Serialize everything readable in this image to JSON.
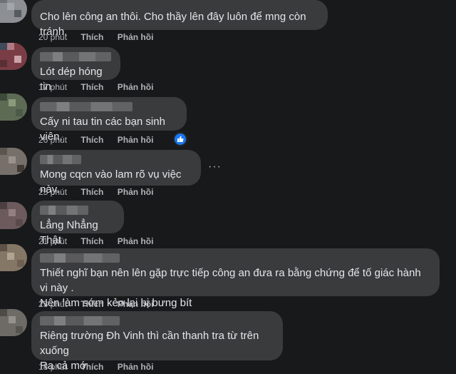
{
  "comments": [
    {
      "text": "Cho lên công an thôi. Cho thầy lên đây luôn để mng còn tránh.",
      "time": "20 phút",
      "like": "Thích",
      "reply": "Phản hồi"
    },
    {
      "text": "Lót dép hóng tin",
      "time": "17 phút",
      "like": "Thích",
      "reply": "Phản hồi"
    },
    {
      "text": "Cấy ni tau tin các bạn sinh viên,",
      "time": "26 phút",
      "like": "Thích",
      "reply": "Phản hồi",
      "reaction": "like-icon"
    },
    {
      "text": "Mong cqcn vào lam rõ vụ việc này.",
      "time": "25 phút",
      "like": "Thích",
      "reply": "Phản hồi",
      "more": "···"
    },
    {
      "text": "Lẳng Nhẳng Thật",
      "time": "21 phút",
      "like": "Thích",
      "reply": "Phản hồi"
    },
    {
      "text": "Thiết nghĩ bạn nên lên gặp trực tiếp công an đưa ra bằng chứng để tố giác hành vi này .\nNên làm sớm kẻo lại bị bưng bít",
      "time": "23 phút",
      "like": "Thích",
      "reply": "Phản hồi"
    },
    {
      "text": "Riêng trường Đh Vinh thì cần thanh tra từ trên xuống\nRa cả mớ",
      "time": "18 phút",
      "like": "Thích",
      "reply": "Phản hồi"
    }
  ],
  "colors": {
    "background": "#18191a",
    "bubble": "#3a3b3c",
    "meta": "#b0b3b8",
    "like_blue": "#1877f2"
  }
}
